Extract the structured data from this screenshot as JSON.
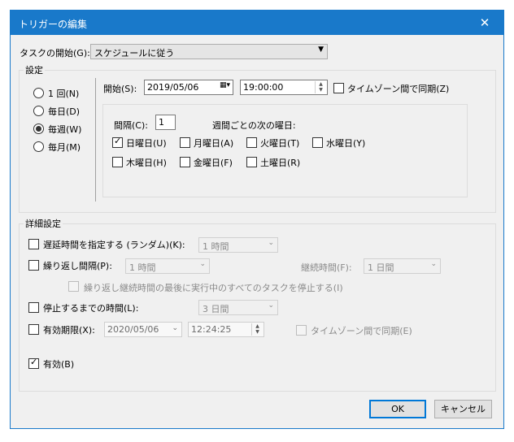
{
  "window": {
    "title": "トリガーの編集",
    "close_label": "✕"
  },
  "task_start": {
    "label": "タスクの開始(G):",
    "value": "スケジュールに従う"
  },
  "settings": {
    "group_label": "設定",
    "freq": [
      "1 回(N)",
      "毎日(D)",
      "毎週(W)",
      "毎月(M)"
    ],
    "start_label": "開始(S):",
    "date": "2019/05/06",
    "time": "19:00:00",
    "sync_tz": "タイムゾーン間で同期(Z)",
    "interval_label": "間隔(C):",
    "interval_value": "1",
    "weekly_label": "週間ごとの次の曜日:",
    "days": [
      "日曜日(U)",
      "月曜日(A)",
      "火曜日(T)",
      "水曜日(Y)",
      "木曜日(H)",
      "金曜日(F)",
      "土曜日(R)"
    ]
  },
  "advanced": {
    "group_label": "詳細設定",
    "delay_label": "遅延時間を指定する (ランダム)(K):",
    "delay_value": "1 時間",
    "repeat_label": "繰り返し間隔(P):",
    "repeat_value": "1 時間",
    "duration_label": "継続時間(F):",
    "duration_value": "1 日間",
    "stop_running_label": "繰り返し継続時間の最後に実行中のすべてのタスクを停止する(I)",
    "stop_after_label": "停止するまでの時間(L):",
    "stop_after_value": "3 日間",
    "expire_label": "有効期限(X):",
    "expire_date": "2020/05/06",
    "expire_time": "12:24:25",
    "expire_sync": "タイムゾーン間で同期(E)",
    "enabled_label": "有効(B)"
  },
  "buttons": {
    "ok": "OK",
    "cancel": "キャンセル"
  }
}
